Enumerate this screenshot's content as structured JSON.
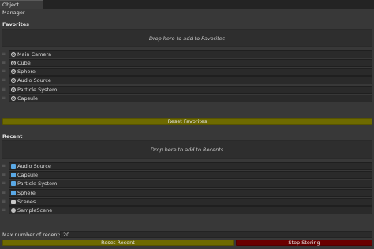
{
  "window": {
    "tab_title": "Object Manager"
  },
  "favorites": {
    "title": "Favorites",
    "drop_hint": "Drop here to add to Favorites",
    "items": [
      {
        "label": "Main Camera",
        "icon": "gameobject-icon"
      },
      {
        "label": "Cube",
        "icon": "gameobject-icon"
      },
      {
        "label": "Sphere",
        "icon": "gameobject-icon"
      },
      {
        "label": "Audio Source",
        "icon": "gameobject-icon"
      },
      {
        "label": "Particle System",
        "icon": "gameobject-icon"
      },
      {
        "label": "Capsule",
        "icon": "gameobject-icon"
      }
    ],
    "reset_label": "Reset Favorites"
  },
  "recent": {
    "title": "Recent",
    "drop_hint": "Drop here to add to Recents",
    "items": [
      {
        "label": "Audio Source",
        "icon": "prefab-icon"
      },
      {
        "label": "Capsule",
        "icon": "prefab-icon"
      },
      {
        "label": "Particle System",
        "icon": "prefab-icon"
      },
      {
        "label": "Sphere",
        "icon": "prefab-icon"
      },
      {
        "label": "Scenes",
        "icon": "folder-icon"
      },
      {
        "label": "SampleScene",
        "icon": "scene-icon"
      }
    ],
    "max_label": "Max number of recents:",
    "max_value": "20",
    "reset_label": "Reset Recent",
    "stop_label": "Stop Storing"
  },
  "colors": {
    "background": "#383838",
    "olive_button": "#6e6a00",
    "red_button": "#6a0000",
    "prefab_blue": "#5aa9e6"
  }
}
